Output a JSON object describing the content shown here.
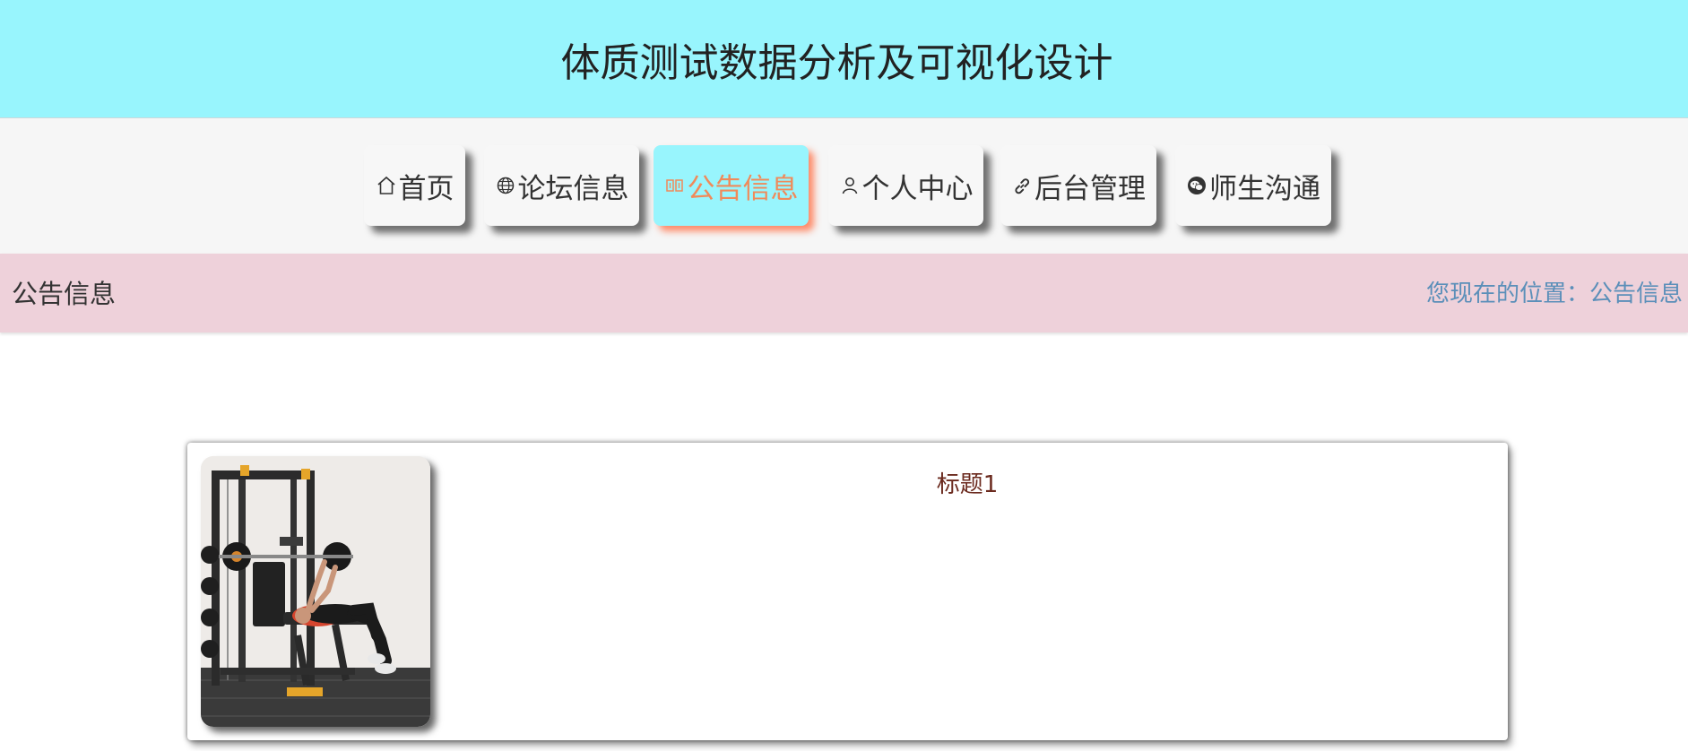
{
  "header": {
    "title": "体质测试数据分析及可视化设计"
  },
  "nav": {
    "items": [
      {
        "label": "首页",
        "icon": "home-icon"
      },
      {
        "label": "论坛信息",
        "icon": "globe-icon"
      },
      {
        "label": "公告信息",
        "icon": "notice-icon",
        "active": true
      },
      {
        "label": "个人中心",
        "icon": "user-icon"
      },
      {
        "label": "后台管理",
        "icon": "link-icon"
      },
      {
        "label": "师生沟通",
        "icon": "wechat-icon"
      }
    ]
  },
  "breadcrumb": {
    "section_title": "公告信息",
    "location": "您现在的位置：公告信息"
  },
  "notices": [
    {
      "title": "标题1",
      "image": "gym-equipment-photo"
    }
  ],
  "colors": {
    "header_bg": "#98f5fd",
    "nav_bg": "#f6f6f6",
    "active_text": "#f08a5a",
    "breadcrumb_bg": "#eed1da",
    "location_text": "#5b8fb9",
    "notice_title": "#6b2a1e"
  }
}
